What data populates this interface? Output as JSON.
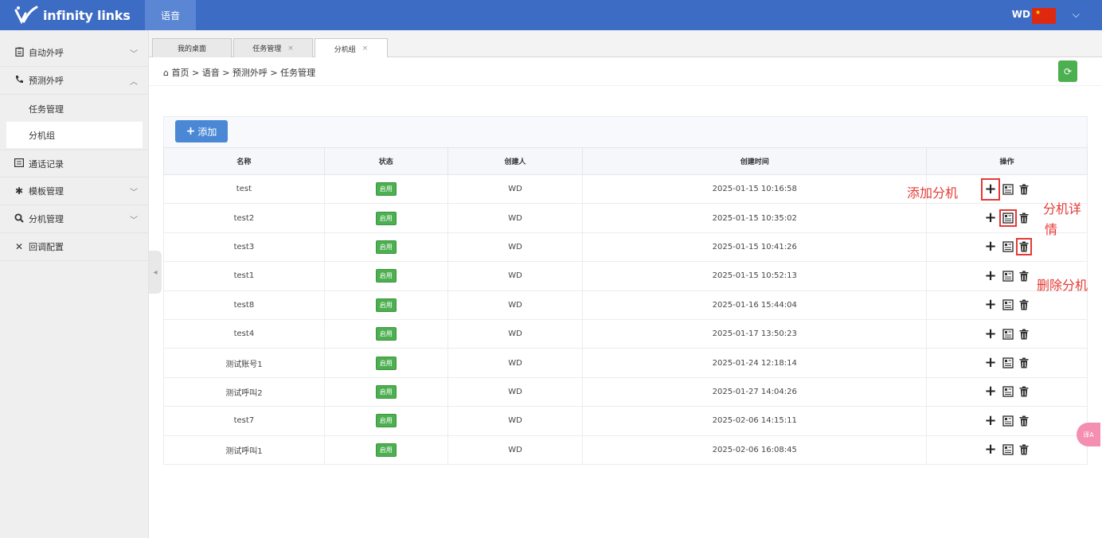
{
  "app": {
    "logo_text": "infinity links",
    "top_menu_label": "语音",
    "user_name": "WD",
    "brand_color": "#3d6cc5"
  },
  "sidebar": {
    "items": [
      {
        "label": "自动外呼",
        "icon": "clipboard-icon",
        "expanded": false
      },
      {
        "label": "预测外呼",
        "icon": "phone-icon",
        "expanded": true
      },
      {
        "label": "任务管理",
        "sub": true
      },
      {
        "label": "分机组",
        "sub": true,
        "active": true
      },
      {
        "label": "通话记录",
        "icon": "record-icon"
      },
      {
        "label": "模板管理",
        "icon": "gear-icon",
        "expanded": false
      },
      {
        "label": "分机管理",
        "icon": "search-icon",
        "expanded": false
      },
      {
        "label": "回调配置",
        "icon": "tools-icon"
      }
    ]
  },
  "tabs": [
    {
      "label": "我的桌面",
      "closable": false
    },
    {
      "label": "任务管理",
      "closable": true
    },
    {
      "label": "分机组",
      "closable": true,
      "active": true
    }
  ],
  "breadcrumb": "首页 > 语音 > 预测外呼 > 任务管理",
  "toolbar": {
    "add_label": "添加"
  },
  "table": {
    "columns": [
      "名称",
      "状态",
      "创建人",
      "创建时间",
      "操作"
    ],
    "rows": [
      {
        "name": "test",
        "status": "启用",
        "creator": "WD",
        "created": "2025-01-15 10:16:58"
      },
      {
        "name": "test2",
        "status": "启用",
        "creator": "WD",
        "created": "2025-01-15 10:35:02"
      },
      {
        "name": "test3",
        "status": "启用",
        "creator": "WD",
        "created": "2025-01-15 10:41:26"
      },
      {
        "name": "test1",
        "status": "启用",
        "creator": "WD",
        "created": "2025-01-15 10:52:13"
      },
      {
        "name": "test8",
        "status": "启用",
        "creator": "WD",
        "created": "2025-01-16 15:44:04"
      },
      {
        "name": "test4",
        "status": "启用",
        "creator": "WD",
        "created": "2025-01-17 13:50:23"
      },
      {
        "name": "测试账号1",
        "status": "启用",
        "creator": "WD",
        "created": "2025-01-24 12:18:14"
      },
      {
        "name": "测试呼叫2",
        "status": "启用",
        "creator": "WD",
        "created": "2025-01-27 14:04:26"
      },
      {
        "name": "test7",
        "status": "启用",
        "creator": "WD",
        "created": "2025-02-06 14:15:11"
      },
      {
        "name": "测试呼叫1",
        "status": "启用",
        "creator": "WD",
        "created": "2025-02-06 16:08:45"
      }
    ],
    "status_color": "#4caf50"
  },
  "annotations": {
    "add_extension": "添加分机",
    "extension_detail_line1": "分机详",
    "extension_detail_line2": "情",
    "delete_extension": "删除分机",
    "color": "#e53935"
  }
}
